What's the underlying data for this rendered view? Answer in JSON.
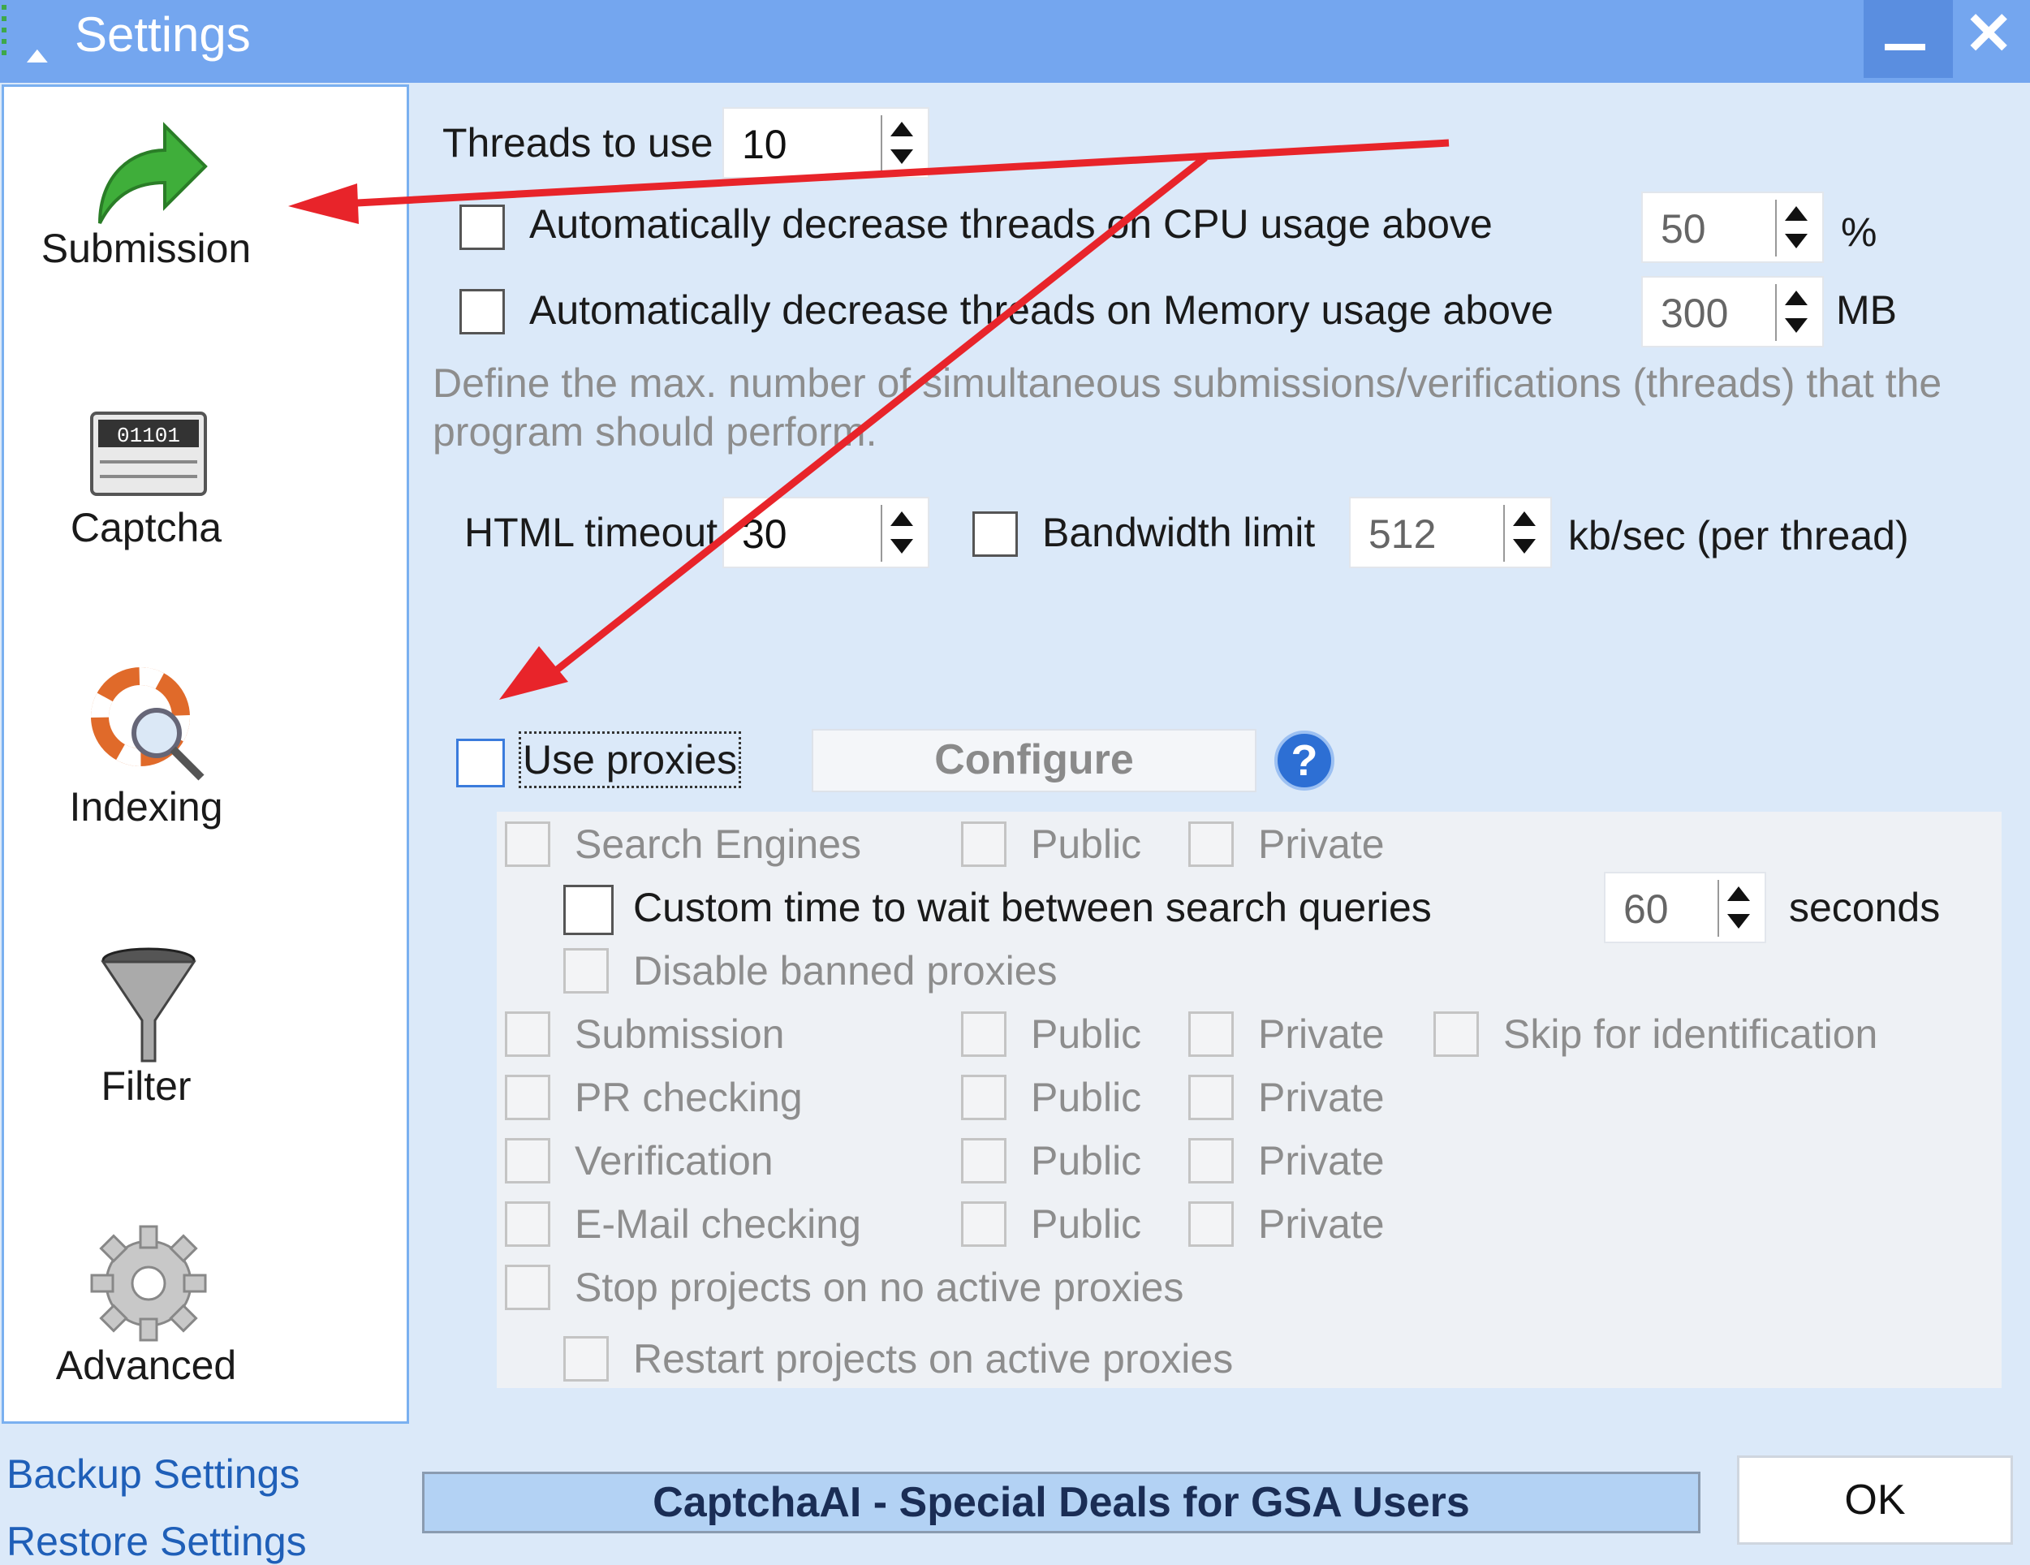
{
  "window": {
    "title": "Settings",
    "title_icon": "up-arrow-icon",
    "minimize_icon": "minimize-icon",
    "close_icon": "close-icon"
  },
  "nav": {
    "items": [
      {
        "label": "Submission",
        "icon": "submission-arrow-icon"
      },
      {
        "label": "Captcha",
        "icon": "captcha-icon"
      },
      {
        "label": "Indexing",
        "icon": "indexing-lifebuoy-icon"
      },
      {
        "label": "Filter",
        "icon": "filter-funnel-icon"
      },
      {
        "label": "Advanced",
        "icon": "gear-icon"
      }
    ]
  },
  "threads": {
    "label": "Threads to use",
    "value": "10",
    "cpu_label": "Automatically decrease threads on CPU usage above",
    "cpu_value": "50",
    "cpu_unit": "%",
    "mem_label": "Automatically decrease threads on Memory usage above",
    "mem_value": "300",
    "mem_unit": "MB",
    "description_line1": "Define the max. number of simultaneous submissions/verifications (threads) that the",
    "description_line2": "program should perform."
  },
  "timeout": {
    "label": "HTML timeout",
    "value": "30",
    "bandwidth_label": "Bandwidth limit",
    "bandwidth_value": "512",
    "bandwidth_unit": "kb/sec (per thread)"
  },
  "proxies": {
    "use_label": "Use proxies",
    "configure_label": "Configure",
    "help_label": "?",
    "search_engines": "Search Engines",
    "custom_wait_label": "Custom time to wait between search queries",
    "custom_wait_value": "60",
    "custom_wait_unit": "seconds",
    "disable_banned": "Disable banned proxies",
    "submission": "Submission",
    "pr_checking": "PR checking",
    "verification": "Verification",
    "email_checking": "E-Mail checking",
    "public": "Public",
    "private": "Private",
    "skip_identification": "Skip for identification",
    "stop_projects": "Stop projects on no active proxies",
    "restart_projects": "Restart projects on active proxies"
  },
  "footer": {
    "backup": "Backup Settings",
    "restore": "Restore Settings",
    "banner": "CaptchaAI - Special Deals for GSA Users",
    "ok": "OK"
  },
  "colors": {
    "accent": "#74a6ef",
    "annotation": "#e8242a",
    "link": "#1f5fb8"
  }
}
